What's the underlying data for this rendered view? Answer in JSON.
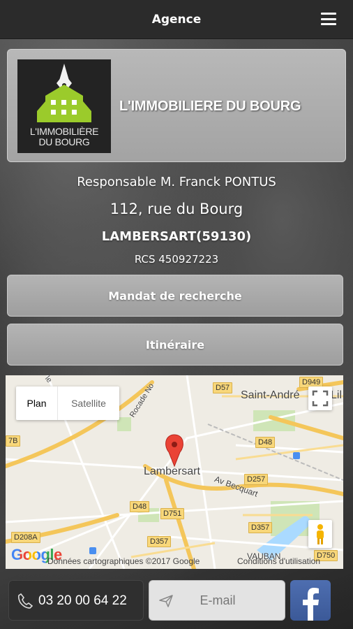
{
  "topbar": {
    "title": "Agence",
    "menu_icon": "hamburger-menu-icon"
  },
  "agency": {
    "logo_line1": "L'IMMOBILIÈRE",
    "logo_line2": "DU BOURG",
    "name": "L'IMMOBILIERE DU BOURG",
    "colors": {
      "logo_green": "#9bcb2b",
      "logo_bg": "#232323"
    }
  },
  "info": {
    "manager": "Responsable M. Franck PONTUS",
    "street": "112, rue du Bourg",
    "city": "LAMBERSART(59130)",
    "rcs": "RCS 450927223"
  },
  "actions": {
    "search_mandate": "Mandat de recherche",
    "itinerary": "Itinéraire"
  },
  "map": {
    "type_plan": "Plan",
    "type_satellite": "Satellite",
    "fullscreen_icon": "fullscreen-icon",
    "pegman_icon": "street-view-pegman-icon",
    "marker_icon": "map-marker-icon",
    "google": "Google",
    "attribution": "Données cartographiques ©2017 Google",
    "terms": "Conditions d'utilisation",
    "place_main": "Lambersart",
    "place_saint_andre": "Saint-André",
    "place_lil": "Lil",
    "place_becquart": "Av Becquart",
    "place_vauban": "VAUBAN",
    "place_rocade": "Rocade No",
    "place_le": "le",
    "roads": [
      "D57",
      "D949",
      "D48",
      "D257",
      "D48",
      "D751",
      "D357",
      "D357",
      "D208A",
      "D750",
      "7B"
    ]
  },
  "footer": {
    "phone": "03 20 00 64 22",
    "phone_icon": "phone-icon",
    "email": "E-mail",
    "email_icon": "send-icon",
    "facebook_icon": "facebook-icon"
  }
}
